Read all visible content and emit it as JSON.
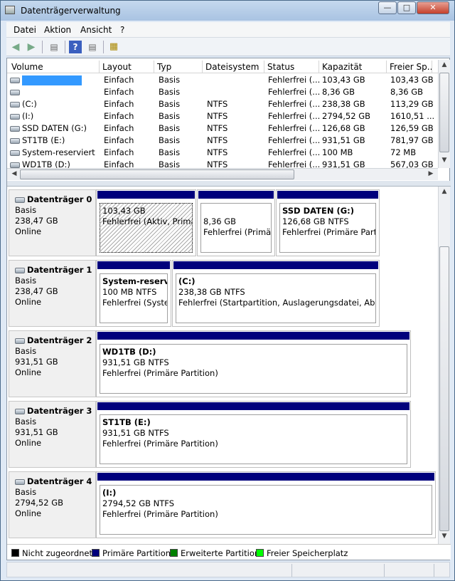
{
  "window": {
    "title": "Datenträgerverwaltung",
    "min_icon": "minimize-icon",
    "max_icon": "maximize-icon",
    "close_icon": "close-icon"
  },
  "menu": [
    "Datei",
    "Aktion",
    "Ansicht",
    "?"
  ],
  "toolbar_icons": [
    "back-arrow-icon",
    "forward-arrow-icon",
    "show-hide-tree-icon",
    "help-icon",
    "properties-icon",
    "disk-wizard-icon"
  ],
  "volume_list": {
    "columns": [
      "Volume",
      "Layout",
      "Typ",
      "Dateisystem",
      "Status",
      "Kapazität",
      "Freier Sp..."
    ],
    "rows": [
      {
        "volume": "",
        "layout": "Einfach",
        "typ": "Basis",
        "fs": "",
        "status": "Fehlerfrei (...",
        "kapazitaet": "103,43 GB",
        "frei": "103,43 GB"
      },
      {
        "volume": "",
        "layout": "Einfach",
        "typ": "Basis",
        "fs": "",
        "status": "Fehlerfrei (...",
        "kapazitaet": "8,36 GB",
        "frei": "8,36 GB"
      },
      {
        "volume": "(C:)",
        "layout": "Einfach",
        "typ": "Basis",
        "fs": "NTFS",
        "status": "Fehlerfrei (...",
        "kapazitaet": "238,38 GB",
        "frei": "113,29 GB"
      },
      {
        "volume": "(I:)",
        "layout": "Einfach",
        "typ": "Basis",
        "fs": "NTFS",
        "status": "Fehlerfrei (...",
        "kapazitaet": "2794,52 GB",
        "frei": "1610,51 ..."
      },
      {
        "volume": "SSD DATEN (G:)",
        "layout": "Einfach",
        "typ": "Basis",
        "fs": "NTFS",
        "status": "Fehlerfrei (...",
        "kapazitaet": "126,68 GB",
        "frei": "126,59 GB"
      },
      {
        "volume": "ST1TB (E:)",
        "layout": "Einfach",
        "typ": "Basis",
        "fs": "NTFS",
        "status": "Fehlerfrei (...",
        "kapazitaet": "931,51 GB",
        "frei": "781,97 GB"
      },
      {
        "volume": "System-reserviert",
        "layout": "Einfach",
        "typ": "Basis",
        "fs": "NTFS",
        "status": "Fehlerfrei (...",
        "kapazitaet": "100 MB",
        "frei": "72 MB"
      },
      {
        "volume": "WD1TB (D:)",
        "layout": "Einfach",
        "typ": "Basis",
        "fs": "NTFS",
        "status": "Fehlerfrei (...",
        "kapazitaet": "931,51 GB",
        "frei": "567,03 GB"
      }
    ]
  },
  "disks": [
    {
      "name": "Datenträger 0",
      "type": "Basis",
      "size": "238,47 GB",
      "state": "Online",
      "partitions": [
        {
          "name": "",
          "size": "103,43 GB",
          "status": "Fehlerfrei (Aktiv, Primäre"
        },
        {
          "name": "",
          "size": "8,36 GB",
          "status": "Fehlerfrei (Primäre"
        },
        {
          "name": "SSD DATEN  (G:)",
          "size": "126,68 GB NTFS",
          "status": "Fehlerfrei (Primäre Partit"
        }
      ]
    },
    {
      "name": "Datenträger 1",
      "type": "Basis",
      "size": "238,47 GB",
      "state": "Online",
      "partitions": [
        {
          "name": "System-reservie",
          "size": "100 MB NTFS",
          "status": "Fehlerfrei (System"
        },
        {
          "name": " (C:)",
          "size": "238,38 GB NTFS",
          "status": "Fehlerfrei (Startpartition, Auslagerungsdatei, Absturz"
        }
      ]
    },
    {
      "name": "Datenträger 2",
      "type": "Basis",
      "size": "931,51 GB",
      "state": "Online",
      "partitions": [
        {
          "name": "WD1TB  (D:)",
          "size": "931,51 GB NTFS",
          "status": "Fehlerfrei (Primäre Partition)"
        }
      ]
    },
    {
      "name": "Datenträger 3",
      "type": "Basis",
      "size": "931,51 GB",
      "state": "Online",
      "partitions": [
        {
          "name": "ST1TB  (E:)",
          "size": "931,51 GB NTFS",
          "status": "Fehlerfrei (Primäre Partition)"
        }
      ]
    },
    {
      "name": "Datenträger 4",
      "type": "Basis",
      "size": "2794,52 GB",
      "state": "Online",
      "partitions": [
        {
          "name": " (I:)",
          "size": "2794,52 GB NTFS",
          "status": "Fehlerfrei (Primäre Partition)"
        }
      ]
    }
  ],
  "legend": [
    {
      "label": "Nicht zugeordnet",
      "color": "#000000"
    },
    {
      "label": "Primäre Partition",
      "color": "#00007c"
    },
    {
      "label": "Erweiterte Partition",
      "color": "#008000"
    },
    {
      "label": "Freier Speicherplatz",
      "color": "#00ff00"
    }
  ]
}
